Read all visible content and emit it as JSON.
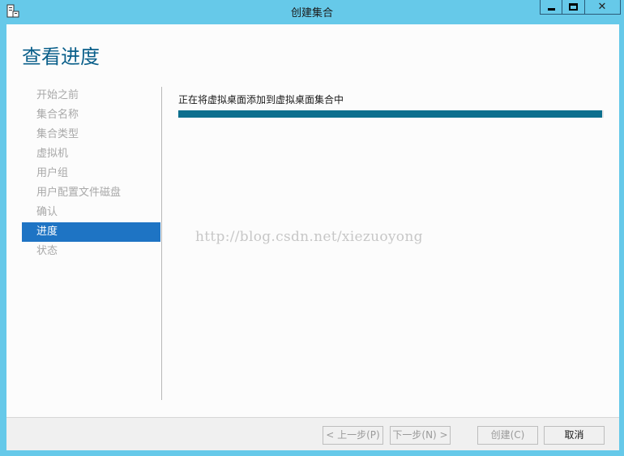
{
  "window": {
    "title": "创建集合",
    "close_glyph": "✕"
  },
  "page": {
    "heading": "查看进度"
  },
  "nav": {
    "items": [
      {
        "label": "开始之前",
        "active": false
      },
      {
        "label": "集合名称",
        "active": false
      },
      {
        "label": "集合类型",
        "active": false
      },
      {
        "label": "虚拟机",
        "active": false
      },
      {
        "label": "用户组",
        "active": false
      },
      {
        "label": "用户配置文件磁盘",
        "active": false
      },
      {
        "label": "确认",
        "active": false
      },
      {
        "label": "进度",
        "active": true
      },
      {
        "label": "状态",
        "active": false
      }
    ]
  },
  "main": {
    "status_text": "正在将虚拟桌面添加到虚拟桌面集合中",
    "progress_percent": 99.6,
    "watermark": "http://blog.csdn.net/xiezuoyong"
  },
  "footer": {
    "prev_label": "< 上一步(P)",
    "next_label": "下一步(N) >",
    "create_label": "创建(C)",
    "cancel_label": "取消"
  },
  "colors": {
    "titlebar": "#66c9e9",
    "heading": "#0a5f8a",
    "nav_active": "#1e74c4",
    "progress": "#0c6f8e"
  }
}
